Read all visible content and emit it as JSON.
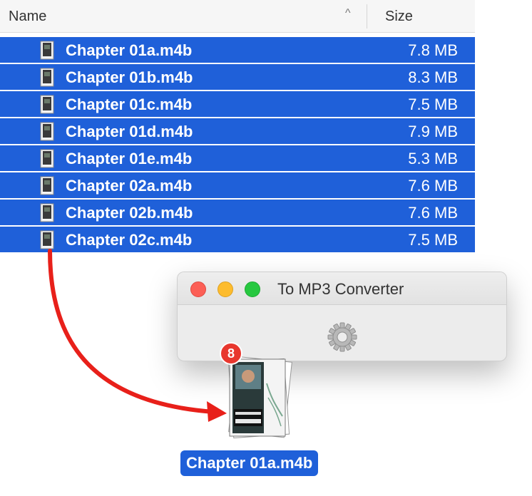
{
  "finder": {
    "header": {
      "name_label": "Name",
      "size_label": "Size",
      "sort_indicator": "^"
    },
    "files": [
      {
        "name": "Chapter 01a.m4b",
        "size": "7.8 MB"
      },
      {
        "name": "Chapter 01b.m4b",
        "size": "8.3 MB"
      },
      {
        "name": "Chapter 01c.m4b",
        "size": "7.5 MB"
      },
      {
        "name": "Chapter 01d.m4b",
        "size": "7.9 MB"
      },
      {
        "name": "Chapter 01e.m4b",
        "size": "5.3 MB"
      },
      {
        "name": "Chapter 02a.m4b",
        "size": "7.6 MB"
      },
      {
        "name": "Chapter 02b.m4b",
        "size": "7.6 MB"
      },
      {
        "name": "Chapter 02c.m4b",
        "size": "7.5 MB"
      }
    ],
    "selection_color": "#1f60d9"
  },
  "window": {
    "title": "To MP3 Converter",
    "icon": "gear-icon"
  },
  "drag": {
    "count": "8",
    "label": "Chapter 01a.m4b",
    "arrow_color": "#e8201a"
  }
}
